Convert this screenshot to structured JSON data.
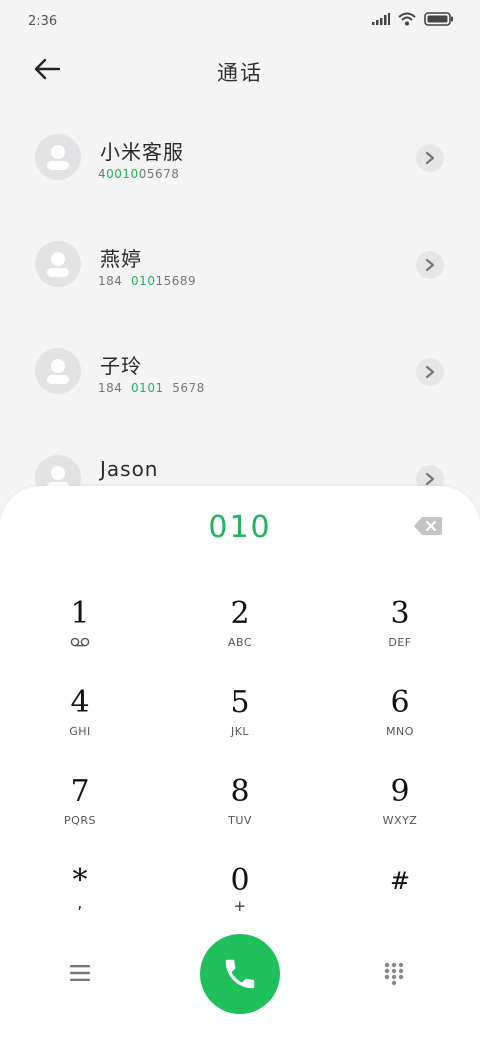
{
  "status_bar": {
    "time": "2:36"
  },
  "header": {
    "title": "通话"
  },
  "contacts": [
    {
      "name": "小米客服",
      "number_parts": [
        {
          "text": "4",
          "hl": false
        },
        {
          "text": "0010",
          "hl": true
        },
        {
          "text": "05678",
          "hl": false
        }
      ]
    },
    {
      "name": "燕婷",
      "number_parts": [
        {
          "text": "184  ",
          "hl": false
        },
        {
          "text": "010",
          "hl": true
        },
        {
          "text": "15689",
          "hl": false
        }
      ]
    },
    {
      "name": "子玲",
      "number_parts": [
        {
          "text": "184  ",
          "hl": false
        },
        {
          "text": "0101",
          "hl": true
        },
        {
          "text": "  5678",
          "hl": false
        }
      ]
    },
    {
      "name": "Jason",
      "number_parts": []
    }
  ],
  "dialpad": {
    "display": "010",
    "keys": [
      {
        "digit": "1",
        "letters": ""
      },
      {
        "digit": "2",
        "letters": "ABC"
      },
      {
        "digit": "3",
        "letters": "DEF"
      },
      {
        "digit": "4",
        "letters": "GHI"
      },
      {
        "digit": "5",
        "letters": "JKL"
      },
      {
        "digit": "6",
        "letters": "MNO"
      },
      {
        "digit": "7",
        "letters": "PQRS"
      },
      {
        "digit": "8",
        "letters": "TUV"
      },
      {
        "digit": "9",
        "letters": "WXYZ"
      },
      {
        "digit": "*",
        "letters": ","
      },
      {
        "digit": "0",
        "letters": "+"
      },
      {
        "digit": "#",
        "letters": ""
      }
    ]
  },
  "colors": {
    "accent": "#1fb35b",
    "call_button": "#1fbf5c",
    "avatar_bg": "#e3e3e6"
  },
  "icons": {
    "back": "arrow-left-icon",
    "detail": "chevron-right-icon",
    "backspace": "backspace-icon",
    "voicemail": "voicemail-icon",
    "menu": "hamburger-menu-icon",
    "call": "phone-icon",
    "keypad": "dialpad-grid-icon"
  }
}
